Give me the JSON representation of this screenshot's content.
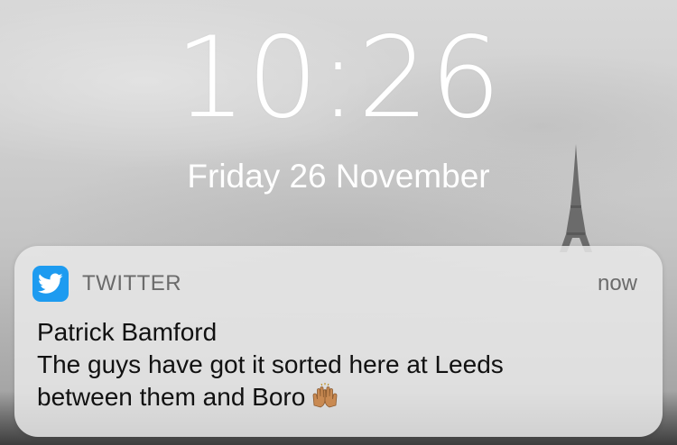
{
  "lock_screen": {
    "time": "10:26",
    "date": "Friday 26 November"
  },
  "notification": {
    "app_name": "TWITTER",
    "app_icon": "twitter-bird-icon",
    "timestamp": "now",
    "title": "Patrick Bamford",
    "message_line1": "The guys have got it sorted here at Leeds",
    "message_line2": "between them and Boro",
    "emoji": "raising-hands-emoji"
  },
  "colors": {
    "twitter_blue": "#1d9bf0",
    "secondary_text": "#6b6b6b",
    "primary_text": "#111111",
    "clock_text": "#ffffff"
  }
}
